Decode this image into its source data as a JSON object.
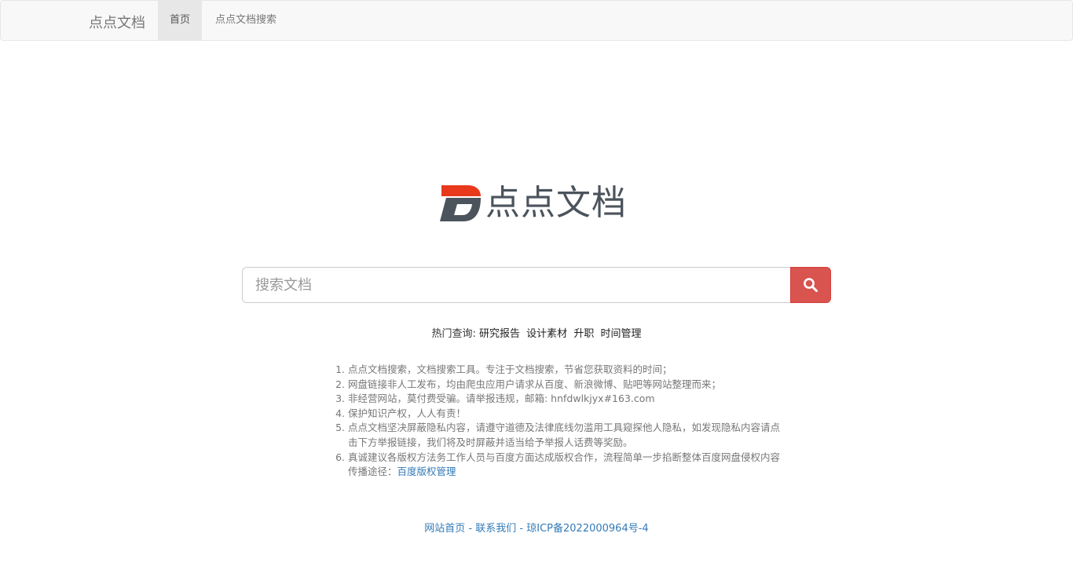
{
  "navbar": {
    "brand": "点点文档",
    "items": [
      {
        "label": "首页"
      },
      {
        "label": "点点文档搜索"
      }
    ]
  },
  "logo": {
    "text": "点点文档",
    "colors": {
      "accent": "#e8391c",
      "slate": "#4b535c"
    }
  },
  "search": {
    "placeholder": "搜索文档",
    "button_icon": "search-icon",
    "button_color": "#d9534f"
  },
  "hot": {
    "label": "热门查询:",
    "items": [
      "研究报告",
      "设计素材",
      "升职",
      "时间管理"
    ]
  },
  "notes": [
    "点点文档搜索，文档搜索工具。专注于文档搜索，节省您获取资料的时间；",
    "网盘链接非人工发布，均由爬虫应用户请求从百度、新浪微博、贴吧等网站整理而来；",
    "非经营网站，莫付费受骗。请举报违规，邮箱: hnfdwlkjyx#163.com",
    "保护知识产权，人人有责！",
    "点点文档坚决屏蔽隐私内容，请遵守道德及法律底线勿滥用工具窥探他人隐私，如发现隐私内容请点击下方举报链接，我们将及时屏蔽并适当给予举报人话费等奖励。",
    "真诚建议各版权方法务工作人员与百度方面达成版权合作，流程简单一步掐断整体百度网盘侵权内容传播途径："
  ],
  "notes_link": "百度版权管理",
  "footer": {
    "home": "网站首页",
    "contact": "联系我们",
    "icp": "琼ICP备2022000964号-4",
    "separator": " - "
  }
}
